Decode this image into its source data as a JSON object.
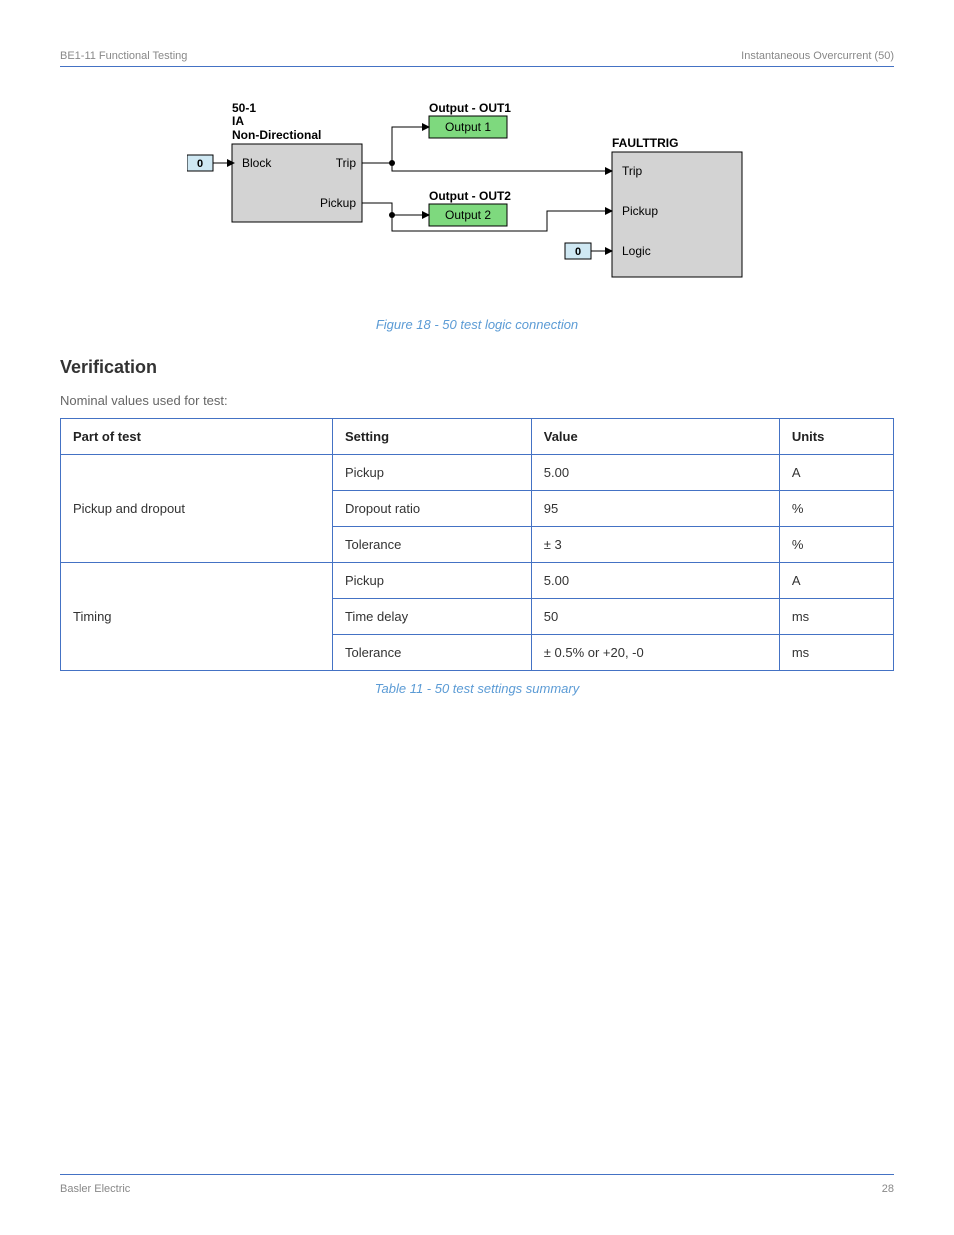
{
  "header": {
    "left": "BE1-11 Functional Testing",
    "right": "Instantaneous Overcurrent (50)"
  },
  "diagram": {
    "block50": {
      "labels": [
        "50-1",
        "IA",
        "Non-Directional"
      ],
      "ports": {
        "block": "Block",
        "trip": "Trip",
        "pickup": "Pickup"
      },
      "input_pin": "0"
    },
    "output1": {
      "title": "Output - OUT1",
      "label": "Output 1"
    },
    "output2": {
      "title": "Output - OUT2",
      "label": "Output 2"
    },
    "faulttrig": {
      "title": "FAULTTRIG",
      "ports": {
        "trip": "Trip",
        "pickup": "Pickup",
        "logic": "Logic"
      },
      "logic_pin": "0"
    }
  },
  "figure_caption": "Figure 18 - 50 test logic connection",
  "section_title": "Verification",
  "test_settings_label": "Nominal values used for test:",
  "chart_data": {
    "type": "table",
    "title": "Table 11 - 50 test settings summary",
    "columns": [
      "Part of test",
      "Setting",
      "Value",
      "Units"
    ],
    "rows": [
      {
        "part": "Pickup and dropout",
        "rows": [
          {
            "setting": "Pickup",
            "value": "5.00",
            "units": "A"
          },
          {
            "setting": "Dropout ratio",
            "value": "95",
            "units": "%"
          },
          {
            "setting": "Tolerance",
            "value": "± 3",
            "units": "%"
          }
        ]
      },
      {
        "part": "Timing",
        "rows": [
          {
            "setting": "Pickup",
            "value": "5.00",
            "units": "A"
          },
          {
            "setting": "Time delay",
            "value": "50",
            "units": "ms"
          },
          {
            "setting": "Tolerance",
            "value": "± 0.5% or +20, -0",
            "units": "ms"
          }
        ]
      }
    ]
  },
  "footer": {
    "left": "Basler Electric",
    "right": "28"
  }
}
